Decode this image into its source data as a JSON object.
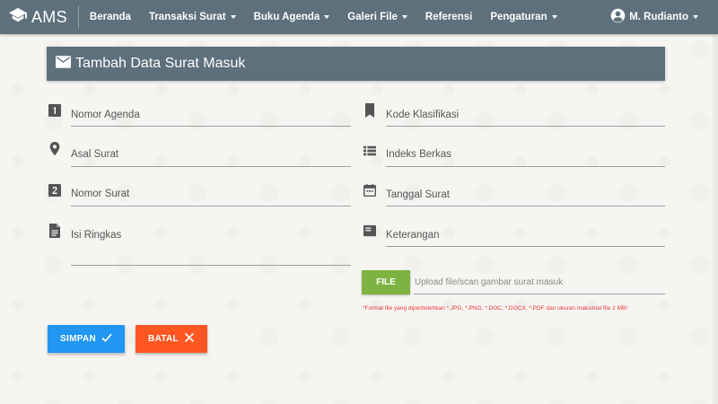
{
  "app": {
    "brand": "AMS"
  },
  "nav": {
    "items": [
      {
        "label": "Beranda",
        "dropdown": false
      },
      {
        "label": "Transaksi Surat",
        "dropdown": true
      },
      {
        "label": "Buku Agenda",
        "dropdown": true
      },
      {
        "label": "Galeri File",
        "dropdown": true
      },
      {
        "label": "Referensi",
        "dropdown": false
      },
      {
        "label": "Pengaturan",
        "dropdown": true
      }
    ],
    "user": "M. Rudianto"
  },
  "page": {
    "title": "Tambah Data Surat Masuk"
  },
  "form": {
    "left": [
      {
        "label": "Nomor Agenda",
        "icon": "looks-one-icon"
      },
      {
        "label": "Asal Surat",
        "icon": "place-icon"
      },
      {
        "label": "Nomor Surat",
        "icon": "looks-two-icon"
      },
      {
        "label": "Isi Ringkas",
        "icon": "description-icon"
      }
    ],
    "right": [
      {
        "label": "Kode Klasifikasi",
        "icon": "bookmark-icon"
      },
      {
        "label": "Indeks Berkas",
        "icon": "view-list-icon"
      },
      {
        "label": "Tanggal Surat",
        "icon": "calendar-icon"
      },
      {
        "label": "Keterangan",
        "icon": "featured-play-list-icon"
      }
    ],
    "file_button": "FILE",
    "upload_placeholder": "Upload file/scan gambar surat masuk",
    "format_note": "*Format file yang diperbolehkan *.JPG, *.PNG, *.DOC, *.DOCX, *.PDF dan ukuran maksimal file 2 MB!"
  },
  "actions": {
    "save": "SIMPAN",
    "cancel": "BATAL"
  },
  "colors": {
    "primary": "#5d707c",
    "save": "#2196f3",
    "cancel": "#ff5722",
    "file": "#7cb342",
    "warning": "#e53935"
  }
}
